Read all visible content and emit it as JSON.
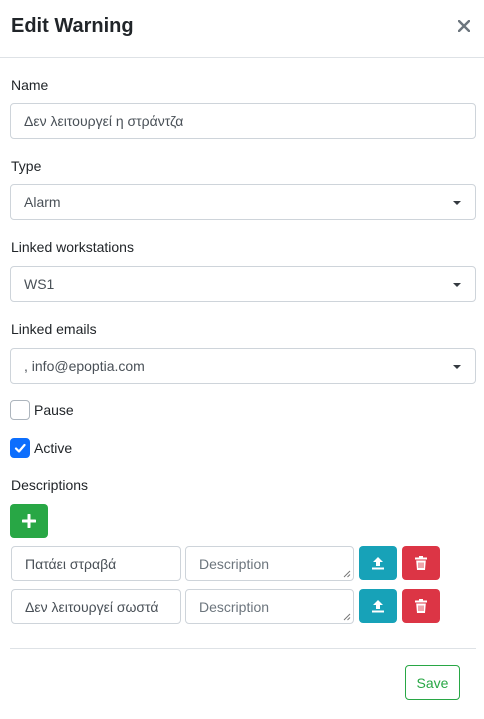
{
  "modal": {
    "title": "Edit Warning",
    "close_icon": "close-icon"
  },
  "form": {
    "name_label": "Name",
    "name_value": "Δεν λειτουργεί η στράντζα",
    "type_label": "Type",
    "type_value": "Alarm",
    "workstations_label": "Linked workstations",
    "workstations_value": "WS1",
    "emails_label": "Linked emails",
    "emails_value": ", info@epoptia.com",
    "pause_label": "Pause",
    "pause_checked": false,
    "active_label": "Active",
    "active_checked": true,
    "descriptions_label": "Descriptions"
  },
  "descriptions": [
    {
      "name": "Πατάει στραβά",
      "description": "",
      "placeholder": "Description"
    },
    {
      "name": "Δεν λειτουργεί σωστά",
      "description": "",
      "placeholder": "Description"
    }
  ],
  "footer": {
    "save_label": "Save"
  },
  "colors": {
    "add_button": "#28a745",
    "upload_button": "#17a2b8",
    "delete_button": "#dc3545",
    "checkbox_checked": "#0d6efd",
    "save_outline": "#28a745"
  },
  "icons": {
    "add": "plus-icon",
    "upload": "upload-icon",
    "delete": "trash-icon",
    "select": "chevron-down-icon",
    "check": "checkmark-icon"
  }
}
